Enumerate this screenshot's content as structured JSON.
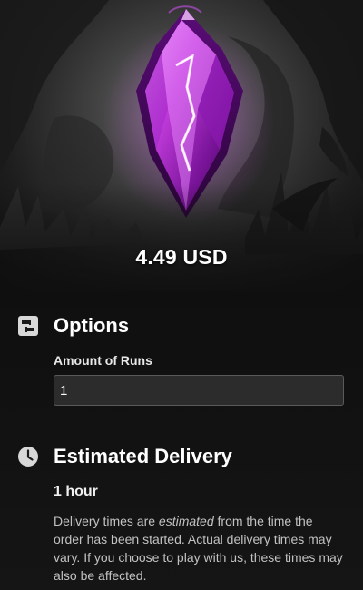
{
  "hero": {
    "price": "4.49 USD",
    "accent_color": "#c23cdc"
  },
  "options": {
    "title": "Options",
    "icon": "options-sliders-icon",
    "runs_label": "Amount of Runs",
    "runs_value": "1"
  },
  "delivery": {
    "title": "Estimated Delivery",
    "icon": "clock-icon",
    "time": "1 hour",
    "note_part1": "Delivery times are ",
    "note_emphasis": "estimated",
    "note_part2": " from the time the order has been started. Actual delivery times may vary. If you choose to play with us, these times may also be affected."
  }
}
